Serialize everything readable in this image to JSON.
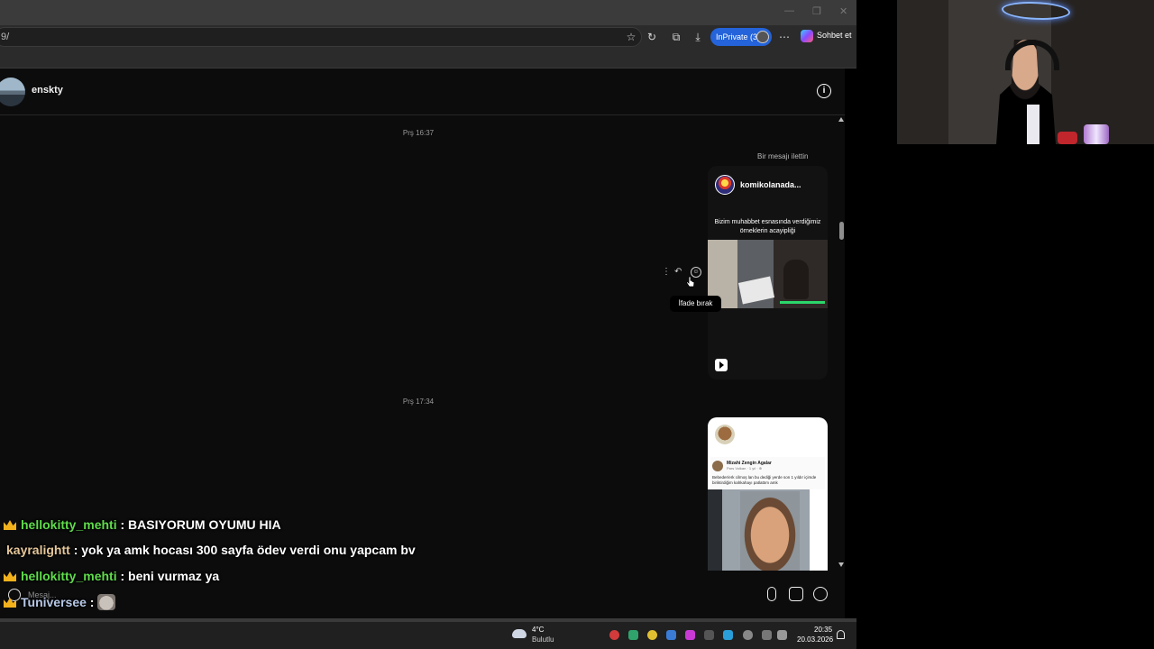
{
  "browser": {
    "address": "9/",
    "inprivate_label": "InPrivate (3)",
    "chat_label": "Sohbet et",
    "window_controls": [
      "—",
      "❐",
      "✕"
    ],
    "toolbar_icons": [
      "star-icon",
      "refresh-icon",
      "extensions-icon",
      "download-icon",
      "more-icon"
    ]
  },
  "chat": {
    "contact_name": "enskty",
    "messages": [
      {
        "timestamp": "Prş 16:37"
      },
      {
        "timestamp": "Prş 17:34"
      }
    ],
    "forward_note": "Bir mesajı ilettin",
    "card1": {
      "account": "komikolanada...",
      "caption": "Bizim muhabbet esnasında verdiğimiz örneklerin acayipliği"
    },
    "card2": {
      "post_name": "Mizahi Zengin Agalar",
      "post_meta": "Pars Volkan · 1 yıl · ⊕",
      "post_text": "Bebeder/erk cilmoş lan bu dediği yerde son 1 yıldır içimde biriktirdiğim kahkahayı patlattım amk"
    },
    "tooltip": "İfade bırak",
    "composer_placeholder": "Mesaj..."
  },
  "overlay_chat": [
    {
      "user": "hellokitty_mehti",
      "text": ": BASIYORUM OYUMU HIA",
      "crown": true,
      "color": "#5fdc4b"
    },
    {
      "user": "kayralightt",
      "text": ": yok ya amk hocası 300 sayfa ödev verdi onu yapcam bv",
      "crown": false,
      "color": "#e6c79a"
    },
    {
      "user": "hellokitty_mehti",
      "text": ": beni vurmaz ya",
      "crown": true,
      "color": "#5fdc4b"
    },
    {
      "user": "Tuniversee",
      "text": ":",
      "crown": true,
      "color": "#b7c8e6"
    }
  ],
  "taskbar": {
    "temperature": "4°C",
    "weather": "Bulutlu",
    "time": "20:35",
    "date": "20.03.2026"
  }
}
